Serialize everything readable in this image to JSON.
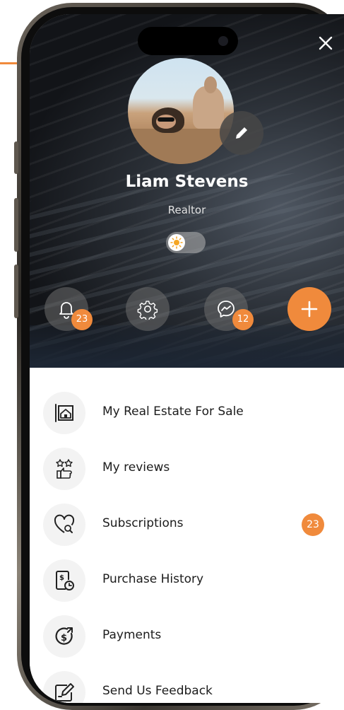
{
  "header": {
    "close_icon": "close-icon",
    "profile": {
      "name": "Liam Stevens",
      "role": "Realtor"
    },
    "theme_toggle": {
      "state": "light",
      "icon": "sun-icon"
    },
    "actions": {
      "notifications": {
        "icon": "bell-icon",
        "badge": "23"
      },
      "settings": {
        "icon": "gear-icon"
      },
      "messages": {
        "icon": "messenger-icon",
        "badge": "12"
      },
      "add": {
        "icon": "plus-icon"
      }
    }
  },
  "menu": {
    "items": [
      {
        "label": "My Real Estate For Sale",
        "icon": "house-frame-icon"
      },
      {
        "label": "My reviews",
        "icon": "stars-thumbs-up-icon"
      },
      {
        "label": "Subscriptions",
        "icon": "heart-search-icon",
        "badge": "23"
      },
      {
        "label": "Purchase History",
        "icon": "receipt-clock-icon"
      },
      {
        "label": "Payments",
        "icon": "dollar-cycle-icon"
      },
      {
        "label": "Send Us Feedback",
        "icon": "edit-note-icon"
      }
    ]
  },
  "colors": {
    "accent": "#F08A3C",
    "text": "#1c1c1c",
    "icon_bg": "#f3f3f3"
  }
}
